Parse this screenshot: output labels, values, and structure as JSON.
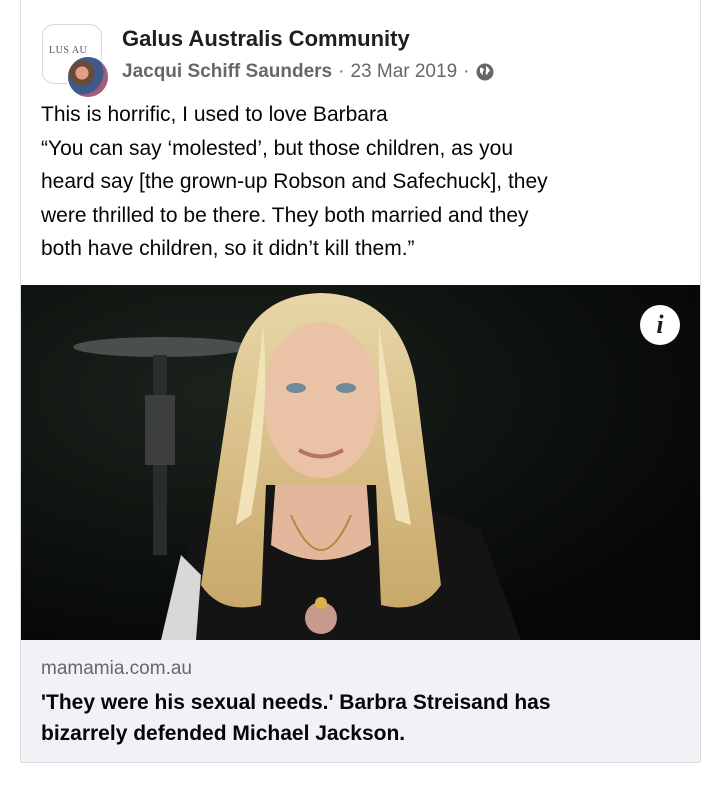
{
  "post": {
    "group_name": "Galus Australis Community",
    "group_logo_text": "LUS AU",
    "author": "Jacqui Schiff Saunders",
    "separator": "·",
    "date": "23 Mar 2019",
    "privacy_icon": "globe-icon",
    "text_lines": [
      "This is horrific, I used to love Barbara",
      "“You can say ‘molested’, but those children, as you",
      "heard say [the grown-up Robson and Safechuck], they",
      "were thrilled to be there. They both married and they",
      "both have children, so it didn’t kill them.”"
    ]
  },
  "image": {
    "info_label": "i"
  },
  "link_preview": {
    "domain": "mamamia.com.au",
    "title_lines": [
      "'They were his sexual needs.' Barbra Streisand has",
      "bizarrely defended Michael Jackson."
    ]
  }
}
